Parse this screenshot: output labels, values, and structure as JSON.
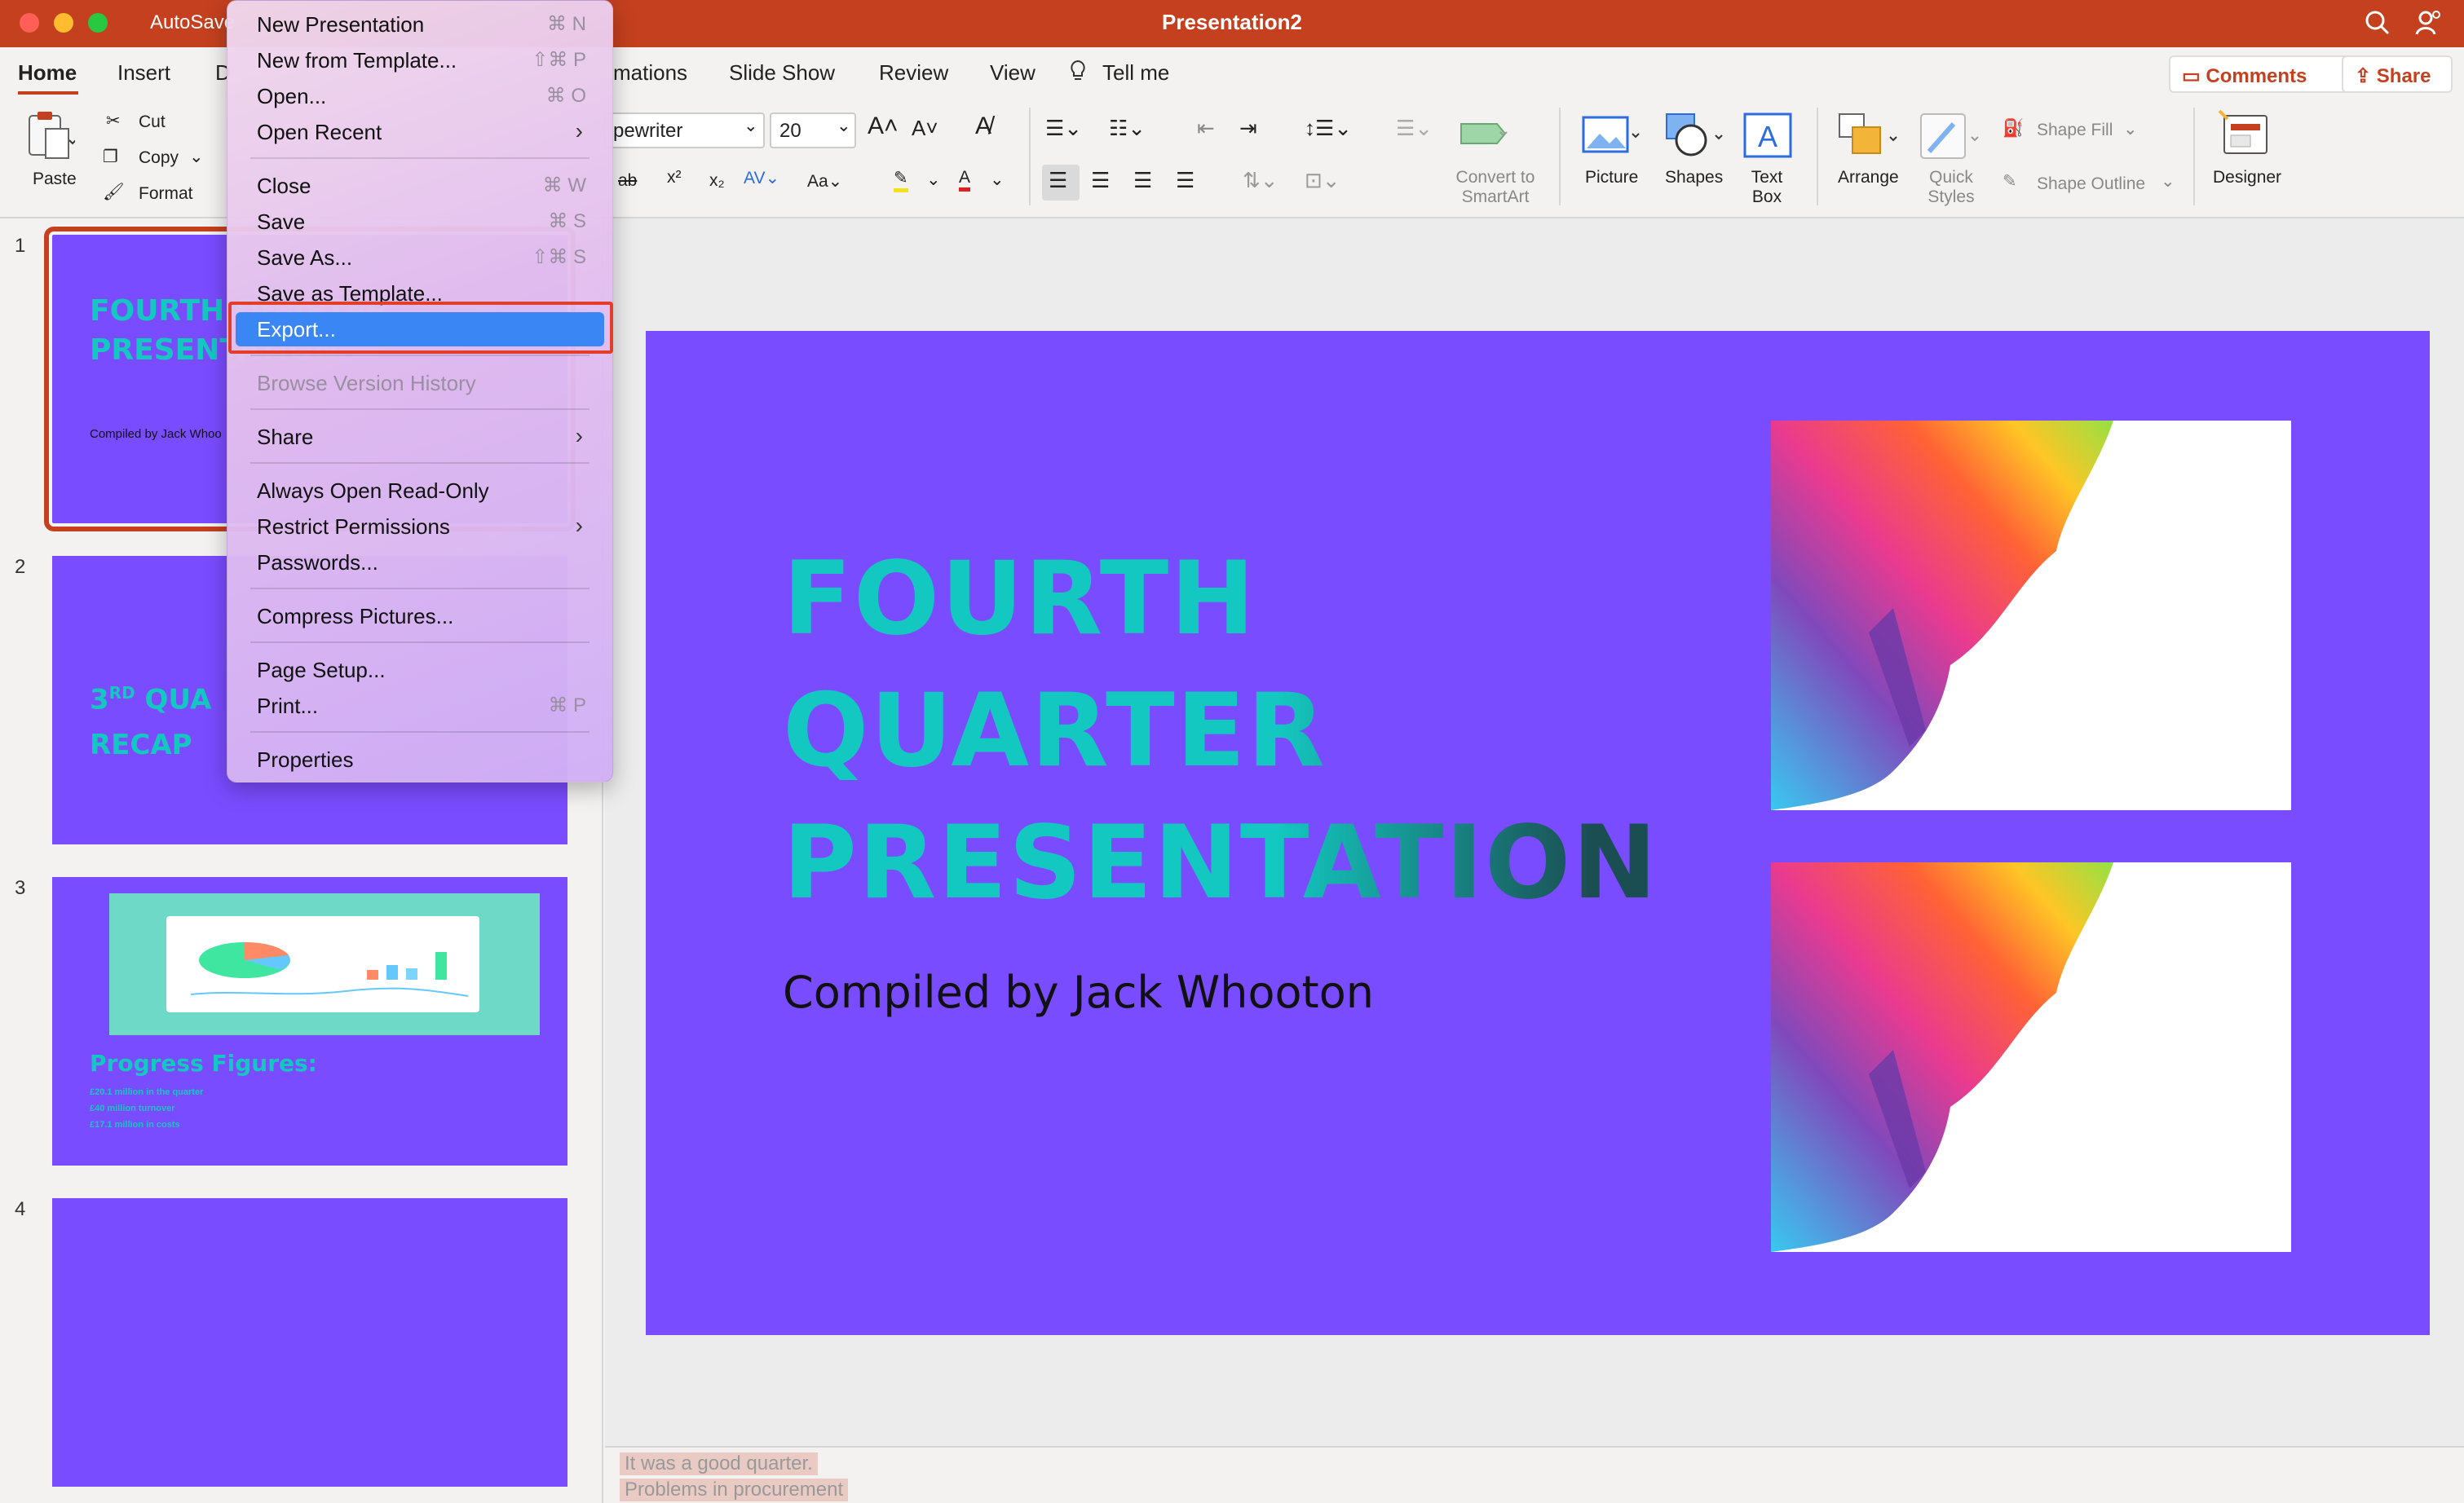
{
  "window": {
    "title": "Presentation2",
    "autosave_label": "AutoSave",
    "icons": [
      "search-icon",
      "person-icon"
    ]
  },
  "tabs": {
    "items": [
      "Home",
      "Insert",
      "D",
      "mations",
      "Slide Show",
      "Review",
      "View"
    ],
    "tell_me": "Tell me",
    "comments": "Comments",
    "share": "Share",
    "accent": "#c4401f"
  },
  "ribbon": {
    "paste": "Paste",
    "cut": "Cut",
    "copy": "Copy",
    "format": "Format",
    "font_name": "pewriter",
    "font_size": "20",
    "convert_smartart": [
      "Convert to",
      "SmartArt"
    ],
    "picture": "Picture",
    "shapes": "Shapes",
    "text_box": [
      "Text",
      "Box"
    ],
    "arrange": "Arrange",
    "quick_styles": [
      "Quick",
      "Styles"
    ],
    "shape_fill": "Shape Fill",
    "shape_outline": "Shape Outline",
    "designer": "Designer"
  },
  "file_menu": {
    "items": [
      {
        "label": "New Presentation",
        "shortcut": "⌘ N"
      },
      {
        "label": "New from Template...",
        "shortcut": "⇧⌘ P"
      },
      {
        "label": "Open...",
        "shortcut": "⌘ O"
      },
      {
        "label": "Open Recent",
        "submenu": true
      },
      {
        "label": "Close",
        "shortcut": "⌘ W"
      },
      {
        "label": "Save",
        "shortcut": "⌘ S"
      },
      {
        "label": "Save As...",
        "shortcut": "⇧⌘ S"
      },
      {
        "label": "Save as Template..."
      },
      {
        "label": "Export...",
        "highlighted": true
      },
      {
        "label": "Browse Version History",
        "disabled": true
      },
      {
        "label": "Share",
        "submenu": true
      },
      {
        "label": "Always Open Read-Only"
      },
      {
        "label": "Restrict Permissions",
        "submenu": true
      },
      {
        "label": "Passwords..."
      },
      {
        "label": "Compress Pictures..."
      },
      {
        "label": "Page Setup..."
      },
      {
        "label": "Print...",
        "shortcut": "⌘ P"
      },
      {
        "label": "Properties"
      }
    ]
  },
  "thumbnails": {
    "numbers": [
      "1",
      "2",
      "3",
      "4"
    ],
    "slide1": {
      "title": "FOURTH QUARTER PRESENTATION",
      "sub": "Compiled by Jack Whoo"
    },
    "slide2": {
      "sup": "RD",
      "title_pre": "3",
      "title": "QUA",
      "title2": "RECAP"
    },
    "slide3": {
      "heading": "Progress Figures:",
      "lines": [
        "£20.1 million in the quarter",
        "£40 million turnover",
        "£17.1 million in costs"
      ]
    }
  },
  "slide": {
    "title_lines": [
      "FOURTH",
      "QUARTER",
      "PRESENTATION"
    ],
    "subtitle": "Compiled by Jack Whooton",
    "background": "#7a4cff",
    "title_color": "#13c8c0"
  },
  "notes": {
    "lines": [
      "It was a good quarter.",
      "Problems in procurement"
    ]
  }
}
